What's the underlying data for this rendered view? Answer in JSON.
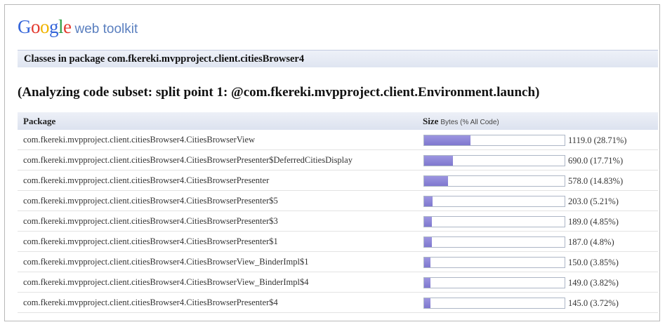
{
  "header": {
    "logo_google": "Google",
    "logo_suffix": "web toolkit",
    "package_title": "Classes in package com.fkereki.mvpproject.client.citiesBrowser4",
    "subset_title": "(Analyzing code subset: split point 1: @com.fkereki.mvpproject.client.Environment.launch)"
  },
  "table": {
    "col_package": "Package",
    "col_size": "Size",
    "col_size_unit": "Bytes (% All Code)",
    "rows": [
      {
        "name": "com.fkereki.mvpproject.client.citiesBrowser4.CitiesBrowserView",
        "value": "1119.0 (28.71%)",
        "percent": 28.71
      },
      {
        "name": "com.fkereki.mvpproject.client.citiesBrowser4.CitiesBrowserPresenter$DeferredCitiesDisplay",
        "value": "690.0 (17.71%)",
        "percent": 17.71
      },
      {
        "name": "com.fkereki.mvpproject.client.citiesBrowser4.CitiesBrowserPresenter",
        "value": "578.0 (14.83%)",
        "percent": 14.83
      },
      {
        "name": "com.fkereki.mvpproject.client.citiesBrowser4.CitiesBrowserPresenter$5",
        "value": "203.0 (5.21%)",
        "percent": 5.21
      },
      {
        "name": "com.fkereki.mvpproject.client.citiesBrowser4.CitiesBrowserPresenter$3",
        "value": "189.0 (4.85%)",
        "percent": 4.85
      },
      {
        "name": "com.fkereki.mvpproject.client.citiesBrowser4.CitiesBrowserPresenter$1",
        "value": "187.0 (4.8%)",
        "percent": 4.8
      },
      {
        "name": "com.fkereki.mvpproject.client.citiesBrowser4.CitiesBrowserView_BinderImpl$1",
        "value": "150.0 (3.85%)",
        "percent": 3.85
      },
      {
        "name": "com.fkereki.mvpproject.client.citiesBrowser4.CitiesBrowserView_BinderImpl$4",
        "value": "149.0 (3.82%)",
        "percent": 3.82
      },
      {
        "name": "com.fkereki.mvpproject.client.citiesBrowser4.CitiesBrowserPresenter$4",
        "value": "145.0 (3.72%)",
        "percent": 3.72
      }
    ]
  },
  "colors": {
    "bar_fill": "#8a83d8",
    "header_bg": "#dfe5f1",
    "logo_suffix": "#5a7fbf",
    "logo_letters": [
      "#3465d9",
      "#e33a2f",
      "#f0b400",
      "#3465d9",
      "#2e9e44",
      "#e33a2f"
    ]
  }
}
